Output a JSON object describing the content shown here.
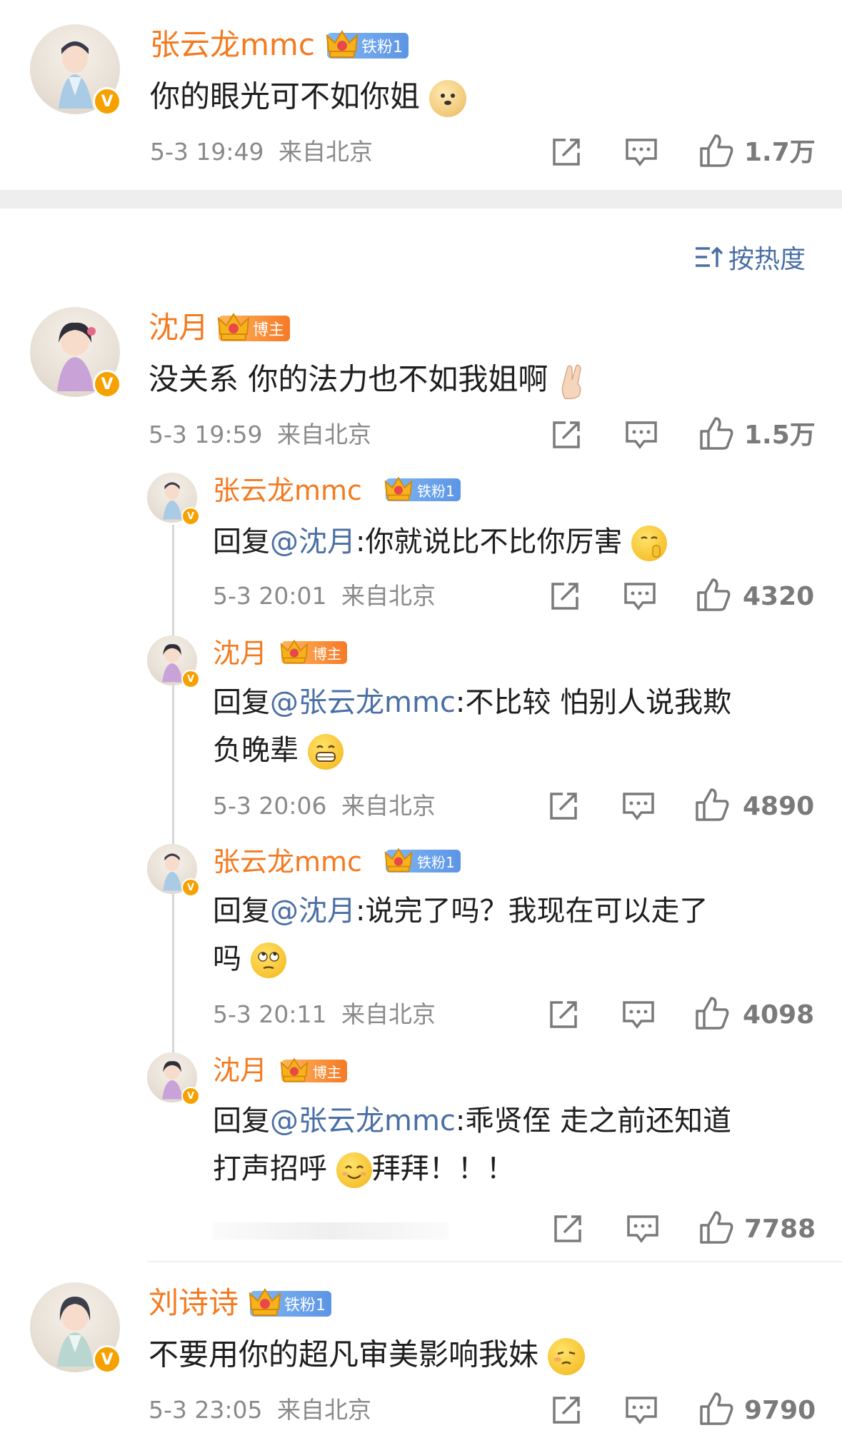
{
  "sort": {
    "label": "按热度"
  },
  "comments": [
    {
      "name": "张云龙mmc",
      "badge": "铁粉1",
      "text": "你的眼光可不如你姐",
      "time": "5-3 19:49",
      "location": "来自北京",
      "likes": "1.7万"
    },
    {
      "name": "沈月",
      "badge": "博主",
      "text": "没关系 你的法力也不如我姐啊",
      "time": "5-3 19:59",
      "location": "来自北京",
      "likes": "1.5万"
    },
    {
      "name": "刘诗诗",
      "badge": "铁粉1",
      "text": "不要用你的超凡审美影响我妹",
      "time": "5-3 23:05",
      "location": "来自北京",
      "likes": "9790"
    }
  ],
  "replies": [
    {
      "name": "张云龙mmc",
      "badge": "铁粉1",
      "prefix": "回复",
      "mention": "@沈月",
      "text": ":你就说比不比你厉害",
      "time": "5-3 20:01",
      "location": "来自北京",
      "likes": "4320"
    },
    {
      "name": "沈月",
      "badge": "博主",
      "prefix": "回复",
      "mention": "@张云龙mmc",
      "text": ":不比较 怕别人说我欺",
      "text2": "负晚辈",
      "time": "5-3 20:06",
      "location": "来自北京",
      "likes": "4890"
    },
    {
      "name": "张云龙mmc",
      "badge": "铁粉1",
      "prefix": "回复",
      "mention": "@沈月",
      "text": ":说完了吗？我现在可以走了",
      "text2": "吗",
      "time": "5-3 20:11",
      "location": "来自北京",
      "likes": "4098"
    },
    {
      "name": "沈月",
      "badge": "博主",
      "prefix": "回复",
      "mention": "@张云龙mmc",
      "text": ":乖贤侄 走之前还知道",
      "text2": "打声招呼",
      "text3": "拜拜！！！",
      "likes": "7788"
    }
  ],
  "icons": {
    "share": "share-icon",
    "comment": "comment-icon",
    "like": "thumbs-up-icon",
    "sort": "sort-icon"
  },
  "colors": {
    "name": "#f47a1f",
    "mention": "#4a6fa5",
    "meta": "#8a8a8a",
    "fan_badge": "#5d95e6",
    "blogger_badge": "#f57a27",
    "verified": "#f6a100"
  }
}
